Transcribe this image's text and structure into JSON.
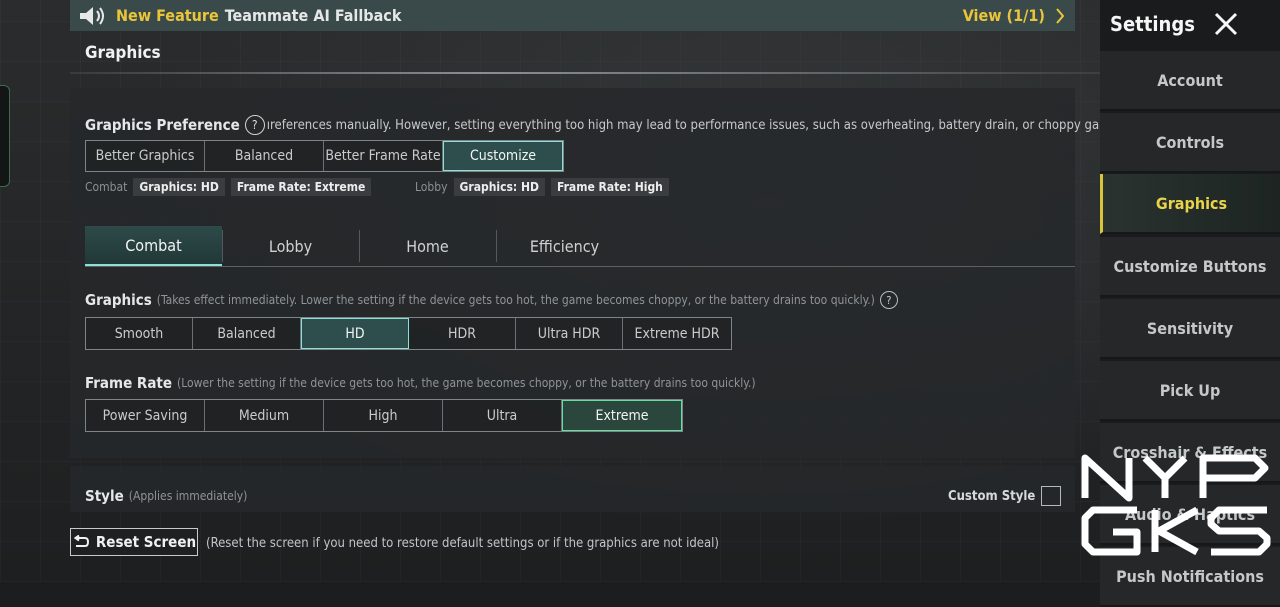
{
  "banner": {
    "new_feature": "New Feature",
    "message": "Teammate AI Fallback",
    "view": "View (1/1)"
  },
  "section_title": "Graphics",
  "graphics_preference": {
    "label": "Graphics Preference",
    "description": "ıreferences manually. However, setting everything too high may lead to performance issues, such as overheating, battery drain, or choppy gameplay.)",
    "options": [
      "Better Graphics",
      "Balanced",
      "Better Frame Rate",
      "Customize"
    ],
    "selected": "Customize"
  },
  "summary": {
    "combat_label": "Combat",
    "combat_graphics": "Graphics: HD",
    "combat_framerate": "Frame Rate: Extreme",
    "lobby_label": "Lobby",
    "lobby_graphics": "Graphics: HD",
    "lobby_framerate": "Frame Rate: High"
  },
  "tabs": [
    "Combat",
    "Lobby",
    "Home",
    "Efficiency"
  ],
  "active_tab": "Combat",
  "graphics": {
    "label": "Graphics",
    "note": "(Takes effect immediately. Lower the setting if the device gets too hot, the game becomes choppy, or the battery drains too quickly.)",
    "options": [
      "Smooth",
      "Balanced",
      "HD",
      "HDR",
      "Ultra HDR",
      "Extreme HDR"
    ],
    "selected": "HD"
  },
  "frame_rate": {
    "label": "Frame Rate",
    "note": "(Lower the setting if the device gets too hot, the game becomes choppy, or the battery drains too quickly.)",
    "options": [
      "Power Saving",
      "Medium",
      "High",
      "Ultra",
      "Extreme"
    ],
    "selected": "Extreme"
  },
  "style": {
    "label": "Style",
    "note": "(Applies immediately)",
    "custom_style": "Custom Style"
  },
  "reset": {
    "button": "Reset Screen",
    "note": "(Reset the screen if you need to restore default settings or if the graphics are not ideal)"
  },
  "sidebar": {
    "title": "Settings",
    "items": [
      "Account",
      "Controls",
      "Graphics",
      "Customize Buttons",
      "Sensitivity",
      "Pick Up",
      "Crosshair & Effects",
      "Audio & Haptics",
      "Push Notifications"
    ],
    "active": "Graphics"
  },
  "watermark": "NYP GKS",
  "colors": {
    "accent_yellow": "#e9c53a",
    "selected_teal": "#8ce0d6",
    "selected_green": "#63e0a4"
  },
  "icons": {
    "banner": "speaker-icon",
    "view": "chevron-right-icon",
    "close": "close-icon",
    "help": "help-icon",
    "reset": "undo-arrow-icon"
  }
}
